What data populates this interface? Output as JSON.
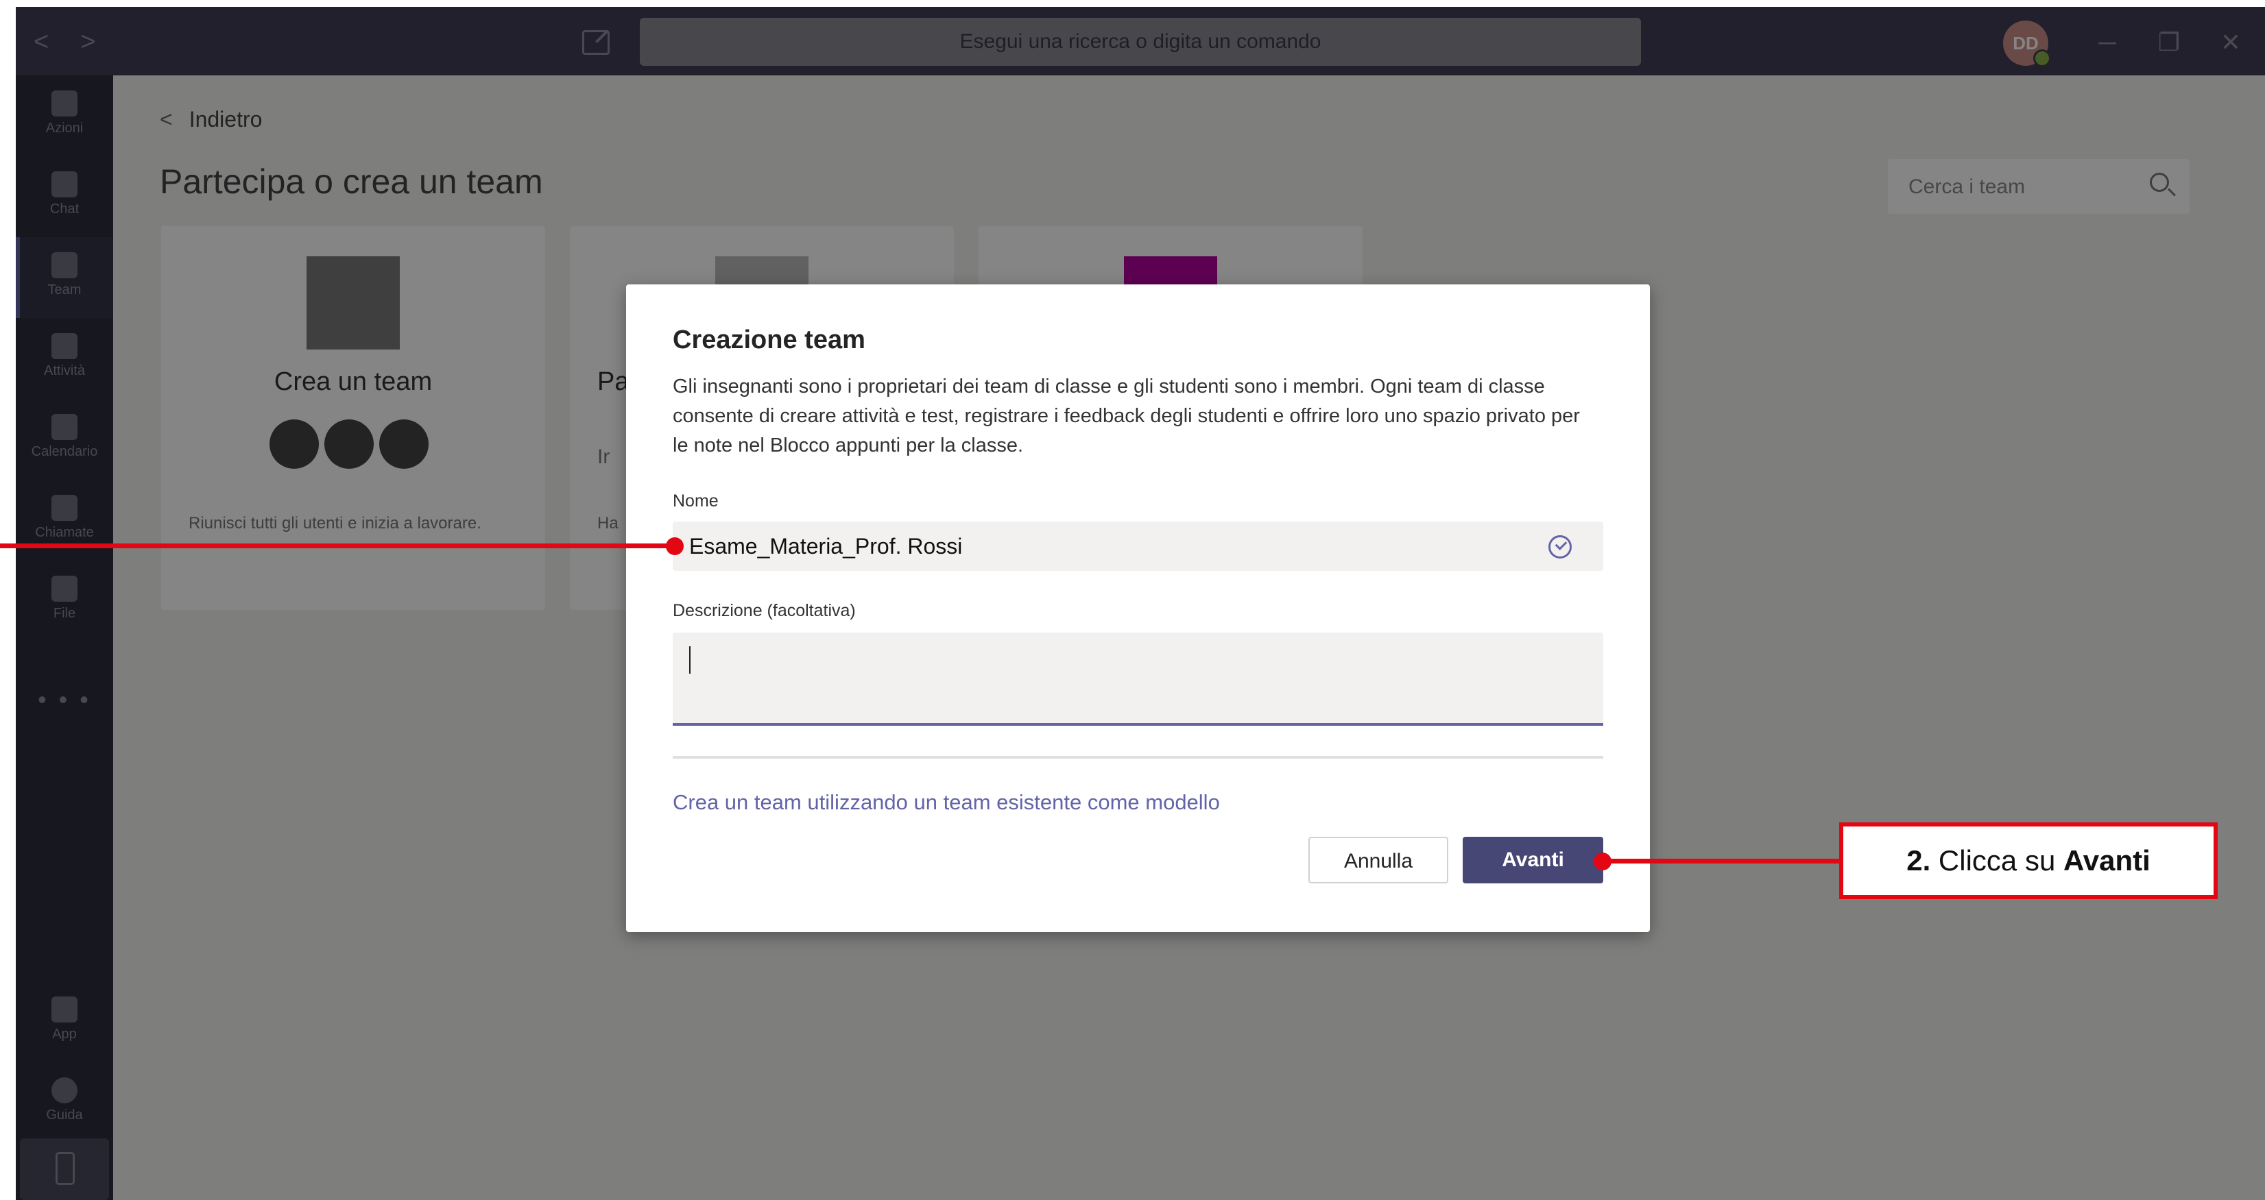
{
  "titlebar": {
    "search_placeholder": "Esegui una ricerca o digita un comando",
    "avatar_initials": "DD",
    "back_arrow": "<",
    "forward_arrow": ">",
    "minimize": "─",
    "maximize": "❐",
    "close": "✕"
  },
  "rail": {
    "items": [
      {
        "label": "Azioni",
        "icon": "bell-icon"
      },
      {
        "label": "Chat",
        "icon": "chat-icon"
      },
      {
        "label": "Team",
        "icon": "team-icon"
      },
      {
        "label": "Attività",
        "icon": "assignments-icon"
      },
      {
        "label": "Calendario",
        "icon": "calendar-icon"
      },
      {
        "label": "Chiamate",
        "icon": "phone-icon"
      },
      {
        "label": "File",
        "icon": "file-icon"
      }
    ],
    "more": "• • •",
    "bottom_items": [
      {
        "label": "App",
        "icon": "apps-icon"
      },
      {
        "label": "Guida",
        "icon": "help-icon"
      }
    ]
  },
  "main": {
    "back_label": "Indietro",
    "title": "Partecipa o crea un team",
    "team_search_placeholder": "Cerca i team",
    "cards": [
      {
        "title": "Crea un team",
        "description": "Riunisci tutti gli utenti e inizia a lavorare."
      },
      {
        "title": "Pa",
        "code_prefix": "Ir",
        "description": "Ha"
      }
    ]
  },
  "dialog": {
    "title": "Creazione team",
    "text": "Gli insegnanti sono i proprietari dei team di classe e gli studenti sono i membri. Ogni team di classe consente di creare attività e test, registrare i feedback degli studenti e offrire loro uno spazio privato per le note nel Blocco appunti per la classe.",
    "name_label": "Nome",
    "name_value": "Esame_Materia_Prof. Rossi",
    "description_label": "Descrizione (facoltativa)",
    "description_value": "",
    "template_link": "Crea un team utilizzando un team esistente come modello",
    "cancel_label": "Annulla",
    "next_label": "Avanti"
  },
  "annotation": {
    "step_number": "2.",
    "step_text": " Clicca su ",
    "step_target": "Avanti",
    "color": "#e30613"
  },
  "colors": {
    "titlebar": "#403f55",
    "rail": "#2c2c3e",
    "accent": "#6264a7",
    "primary_button": "#464775"
  }
}
